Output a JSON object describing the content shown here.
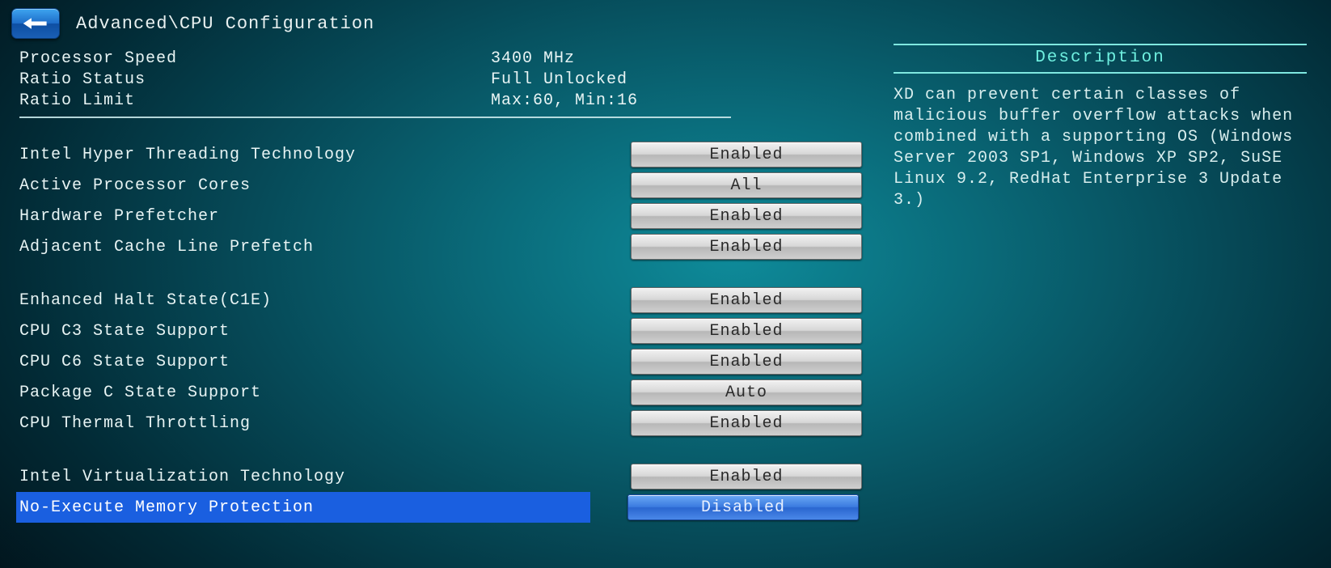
{
  "header": {
    "breadcrumb": "Advanced\\CPU Configuration"
  },
  "info": [
    {
      "label": "Processor Speed",
      "value": "3400 MHz"
    },
    {
      "label": "Ratio Status",
      "value": "Full Unlocked"
    },
    {
      "label": "Ratio Limit",
      "value": "Max:60, Min:16"
    }
  ],
  "groups": [
    [
      {
        "label": "Intel Hyper Threading Technology",
        "value": "Enabled",
        "selected": false
      },
      {
        "label": "Active Processor Cores",
        "value": "All",
        "selected": false
      },
      {
        "label": "Hardware Prefetcher",
        "value": "Enabled",
        "selected": false
      },
      {
        "label": "Adjacent Cache Line Prefetch",
        "value": "Enabled",
        "selected": false
      }
    ],
    [
      {
        "label": "Enhanced Halt State(C1E)",
        "value": "Enabled",
        "selected": false
      },
      {
        "label": "CPU C3 State Support",
        "value": "Enabled",
        "selected": false
      },
      {
        "label": "CPU C6 State Support",
        "value": "Enabled",
        "selected": false
      },
      {
        "label": "Package C State Support",
        "value": "Auto",
        "selected": false
      },
      {
        "label": "CPU Thermal Throttling",
        "value": "Enabled",
        "selected": false
      }
    ],
    [
      {
        "label": "Intel Virtualization Technology",
        "value": "Enabled",
        "selected": false
      },
      {
        "label": "No-Execute Memory Protection",
        "value": "Disabled",
        "selected": true
      }
    ]
  ],
  "description": {
    "title": "Description",
    "text": "XD can prevent certain classes of malicious buffer overflow attacks when combined with a supporting OS (Windows Server 2003 SP1, Windows XP SP2, SuSE Linux 9.2, RedHat Enterprise 3 Update 3.)"
  }
}
